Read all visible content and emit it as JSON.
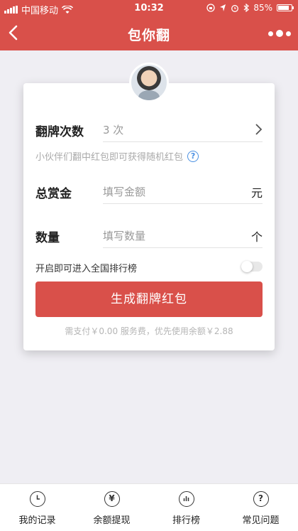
{
  "status_bar": {
    "carrier": "中国移动",
    "time": "10:32",
    "battery_percent": "85%",
    "battery_level": 0.85
  },
  "nav": {
    "title": "包你翻"
  },
  "form": {
    "flip_count": {
      "label": "翻牌次数",
      "value": "3 次"
    },
    "hint": "小伙伴们翻中红包即可获得随机红包",
    "reward": {
      "label": "总赏金",
      "placeholder": "填写金额",
      "unit": "元"
    },
    "quantity": {
      "label": "数量",
      "placeholder": "填写数量",
      "unit": "个"
    },
    "leaderboard_toggle": {
      "label": "开启即可进入全国排行榜",
      "on": false
    },
    "submit_label": "生成翻牌红包",
    "fee_text": "需支付￥0.00 服务费，优先使用余额￥2.88"
  },
  "tabs": [
    {
      "label": "我的记录",
      "icon": "clock-icon"
    },
    {
      "label": "余额提现",
      "icon": "yuan-icon"
    },
    {
      "label": "排行榜",
      "icon": "ranking-icon"
    },
    {
      "label": "常见问题",
      "icon": "question-icon"
    }
  ],
  "colors": {
    "accent": "#d9504a",
    "background": "#efeef3"
  }
}
